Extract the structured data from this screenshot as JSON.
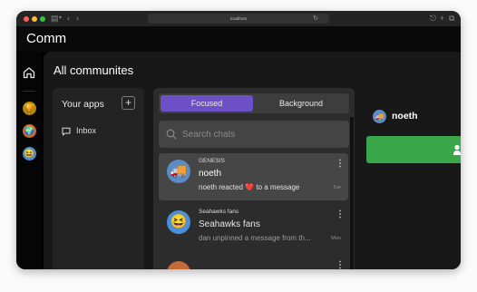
{
  "browser": {
    "url": "localhost",
    "colors": {
      "close": "#fe5f57",
      "minimize": "#febc2e",
      "maximize": "#28c840"
    }
  },
  "app": {
    "title": "Comm"
  },
  "sidebar": {
    "avatars": [
      {
        "name": "trophy-avatar",
        "icon": "🏆",
        "color": "#b8860b"
      },
      {
        "name": "globe-avatar",
        "icon": "🌍",
        "color": "#d2691e"
      },
      {
        "name": "smile-avatar",
        "icon": "😆",
        "color": "#4a90d9"
      }
    ]
  },
  "page": {
    "title": "All communites"
  },
  "apps": {
    "title": "Your apps",
    "add_label": "+",
    "inbox_label": "Inbox"
  },
  "chats": {
    "tabs": {
      "focused": "Focused",
      "background": "Background"
    },
    "search_placeholder": "Search chats",
    "items": [
      {
        "community": "GENESIS",
        "name": "noeth",
        "message_pre": "noeth reacted ",
        "message_emoji": "❤️",
        "message_post": " to a message",
        "time": "Tue",
        "avatar": "🚚"
      },
      {
        "community": "Seahawks fans",
        "name": "Seahawks fans",
        "message": "dan unpinned a message from th...",
        "time": "Mon",
        "avatar": "😆"
      }
    ]
  },
  "thread": {
    "title": "noeth",
    "avatar": "🚚",
    "accent": "#3aa64a"
  },
  "accent": "#6d4fc6"
}
